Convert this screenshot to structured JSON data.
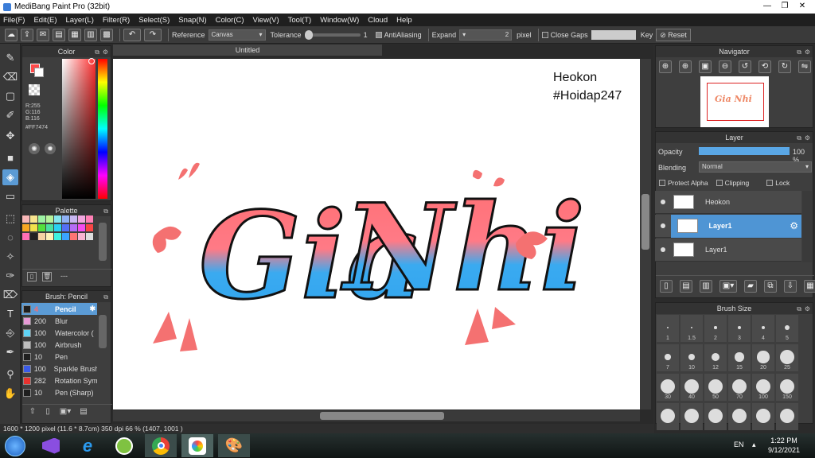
{
  "window": {
    "title": "MediBang Paint Pro (32bit)"
  },
  "menu": [
    "File(F)",
    "Edit(E)",
    "Layer(L)",
    "Filter(R)",
    "Select(S)",
    "Snap(N)",
    "Color(C)",
    "View(V)",
    "Tool(T)",
    "Window(W)",
    "Cloud",
    "Help"
  ],
  "toolbar": {
    "reference_label": "Reference",
    "reference_value": "Canvas",
    "tolerance_label": "Tolerance",
    "tolerance_value": "1",
    "antialias_label": "AntiAliasing",
    "expand_label": "Expand",
    "expand_value": "2",
    "pixel_label": "pixel",
    "close_gaps_label": "Close Gaps",
    "key_label": "Key",
    "reset_label": "Reset"
  },
  "color_panel": {
    "title": "Color",
    "r": "R:255",
    "g": "G:116",
    "b": "B:116",
    "hex": "#FF7474",
    "fg_color": "#ff4a4a"
  },
  "palette_panel": {
    "title": "Palette",
    "extra": "---"
  },
  "brush_panel": {
    "title": "Brush: Pencil",
    "items": [
      {
        "size": "4",
        "name": "Pencil",
        "color": "#1f1f1f"
      },
      {
        "size": "200",
        "name": "Blur",
        "color": "#e79ad6"
      },
      {
        "size": "100",
        "name": "Watercolor (",
        "color": "#5fd3f5"
      },
      {
        "size": "100",
        "name": "Airbrush",
        "color": "#bdbdbd"
      },
      {
        "size": "10",
        "name": "Pen",
        "color": "#1f1f1f"
      },
      {
        "size": "100",
        "name": "Sparkle Brush",
        "color": "#3a5be8"
      },
      {
        "size": "282",
        "name": "Rotation Sym",
        "color": "#e8322f"
      },
      {
        "size": "10",
        "name": "Pen (Sharp)",
        "color": "#1f1f1f"
      }
    ]
  },
  "document": {
    "tab": "Untitled",
    "text_line1": "Heokon",
    "text_line2": "#Hoidap247",
    "art_word1": "Gia",
    "art_word2": "Nhi"
  },
  "status": {
    "text": "1600 * 1200 pixel  (11.6 * 8.7cm)  350 dpi  66 %   (1407, 1001 )"
  },
  "navigator": {
    "title": "Navigator"
  },
  "layer_panel": {
    "title": "Layer",
    "opacity_label": "Opacity",
    "opacity_value": "100 %",
    "opacity_fraction": 1.0,
    "blending_label": "Blending",
    "blending_value": "Normal",
    "protect_alpha": "Protect Alpha",
    "clipping": "Clipping",
    "lock": "Lock",
    "layers": [
      {
        "name": "Heokon",
        "selected": false
      },
      {
        "name": "Layer1",
        "selected": true
      },
      {
        "name": "Layer1",
        "selected": false
      }
    ]
  },
  "brush_size_panel": {
    "title": "Brush Size",
    "sizes": [
      "1",
      "1.5",
      "2",
      "3",
      "4",
      "5",
      "7",
      "10",
      "12",
      "15",
      "20",
      "25",
      "30",
      "40",
      "50",
      "70",
      "100",
      "150"
    ]
  },
  "taskbar": {
    "lang": "EN",
    "time": "1:22 PM",
    "date": "9/12/2021"
  }
}
